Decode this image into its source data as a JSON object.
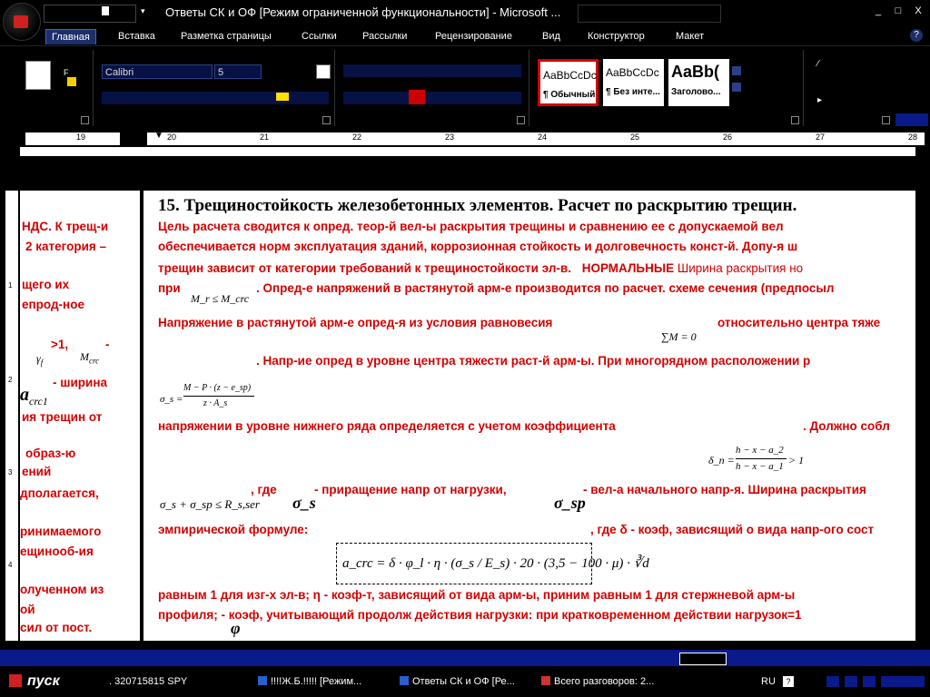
{
  "window": {
    "title": "Ответы СК и ОФ [Режим ограниченной функциональности] - Microsoft ...",
    "controls": {
      "minimize": "_",
      "maximize": "□",
      "close": "X"
    }
  },
  "ribbon_tabs": [
    "Главная",
    "Вставка",
    "Разметка страницы",
    "Ссылки",
    "Рассылки",
    "Рецензирование",
    "Вид",
    "Конструктор",
    "Макет"
  ],
  "ribbon": {
    "font_name": "Calibri",
    "font_size": "5",
    "styles": [
      {
        "preview": "AaBbCcDc",
        "label": "¶ Обычный"
      },
      {
        "preview": "AaBbCcDc",
        "label": "¶ Без инте..."
      },
      {
        "preview": "AaBb(",
        "label": "Заголово..."
      }
    ]
  },
  "ruler": {
    "labels": [
      "19",
      "20",
      "21",
      "22",
      "23",
      "24",
      "25",
      "26",
      "27",
      "28"
    ]
  },
  "left_ruler": {
    "labels": [
      "1",
      "2",
      "3",
      "4"
    ]
  },
  "document": {
    "heading": "15. Трещиностойкость железобетонных элементов. Расчет по раскрытию трещин.",
    "left_column": [
      "НДС. К трещ-и",
      "2 категория –",
      "щего их",
      "епрод-ное",
      ">1,",
      "-",
      "- ширина",
      "ия трещин от",
      "образ-ю",
      "ений",
      "дполагается,",
      "ринимаемого",
      "ещинооб-ия",
      "олученном из",
      "ой",
      "сил от пост."
    ],
    "left_formulas": {
      "gamma_f": "γ",
      "gamma_f_sub": "f",
      "m_crc": "M",
      "m_crc_sub": "crc",
      "a_crc1": "a",
      "a_crc1_sub": "crc1"
    },
    "lines": {
      "l1": "Цель  расчета  сводится  к  опред.  теор-й  вел-ы  раскрытия  трещины  и  сравнению  ее  с  допускаемой  вел",
      "l2": "обеспечивается  норм  эксплуатация  зданий,  коррозионная  стойкость  и  долговечность  конст-й.  Допу-я  ш",
      "l3a": "трещин зависит от категории требований к трещиностойкости эл-в.",
      "l3b": "НОРМАЛЬНЫЕ",
      "l3c": "Ширина раскрытия но",
      "l4a": "при",
      "l4b": ". Опред-е напряжений в растянутой арм-е производится по расчет. схеме сечения (предпосыл",
      "l5a": "Напряжение   в   растянутой   арм-е   опред-я   из   условия   равновесия",
      "l5b": "относительно   центра   тяже",
      "l6": ". Напр-ие опред в уровне центра тяжести раст-й арм-ы. При многорядном расположении р",
      "l7a": "напряжении  в  уровне  нижнего  ряда  определяется  с  учетом  коэффициента",
      "l7b": ".   Должно  собл",
      "l8a": ", где",
      "l8b": "- приращение напр от нагрузки,",
      "l8c": "- вел-а начального напр-я. Ширина раскрытия",
      "l9a": "эмпирической формуле:",
      "l9b": ", где δ - коэф, зависящий о вида напр-ого сост",
      "l10": "равным 1 для изг-х эл-в;    η - коэф-т, зависящий от вида арм-ы, приним равным 1 для стержневой арм-ы",
      "l11": "профиля;    - коэф, учитывающий продолж действия нагрузки: при кратковременном действии нагрузок=1"
    },
    "formulas": {
      "mr_le_mcrc": "M_r ≤ M_crc",
      "sum_m": "∑M = 0",
      "sigma_s_num": "M − P · (z − e_sp)",
      "sigma_s_lhs": "σ_s =",
      "sigma_s_den": "z · A_s",
      "delta_n_lhs": "δ_n =",
      "delta_n_num": "h − x − a_2",
      "delta_n_den": "h − x − a_1",
      "delta_n_rhs": "> 1",
      "sum_sigma": "σ_s + σ_sp ≤ R_s,ser",
      "sigma_s": "σ_s",
      "sigma_sp": "σ_sp",
      "a_crc": "a_crc = δ · φ_l · η · (σ_s / E_s) · 20 · (3,5 − 100 · μ) · ∛d",
      "phi": "φ"
    }
  },
  "taskbar": {
    "start": "пуск",
    "items": [
      ". 320715815 SPY",
      "!!!!Ж.Б.!!!!! [Режим...",
      "Ответы СК и ОФ [Ре...",
      "Всего разговоров: 2..."
    ],
    "lang": "RU"
  }
}
